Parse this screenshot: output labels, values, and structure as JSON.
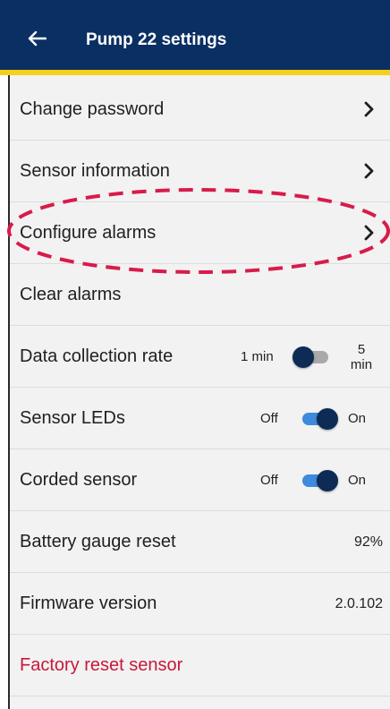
{
  "header": {
    "title": "Pump 22 settings",
    "back_icon": "back-arrow-icon",
    "background": "#0a2f63",
    "accent": "#f6cf1a"
  },
  "rows": {
    "change_password": {
      "label": "Change password"
    },
    "sensor_information": {
      "label": "Sensor information"
    },
    "configure_alarms": {
      "label": "Configure alarms"
    },
    "clear_alarms": {
      "label": "Clear alarms"
    },
    "data_collection_rate": {
      "label": "Data collection rate",
      "option_left": "1 min",
      "option_right_line1": "5",
      "option_right_line2": "min",
      "state": "off"
    },
    "sensor_leds": {
      "label": "Sensor LEDs",
      "option_left": "Off",
      "option_right": "On",
      "state": "on"
    },
    "corded_sensor": {
      "label": "Corded sensor",
      "option_left": "Off",
      "option_right": "On",
      "state": "on"
    },
    "battery_gauge_reset": {
      "label": "Battery gauge reset",
      "value": "92%"
    },
    "firmware_version": {
      "label": "Firmware version",
      "value": "2.0.102"
    },
    "factory_reset": {
      "label": "Factory reset sensor",
      "color": "#c7183a"
    }
  },
  "annotation": {
    "color": "#d81b4a",
    "style": "dashed-ellipse",
    "target": "Configure alarms"
  }
}
